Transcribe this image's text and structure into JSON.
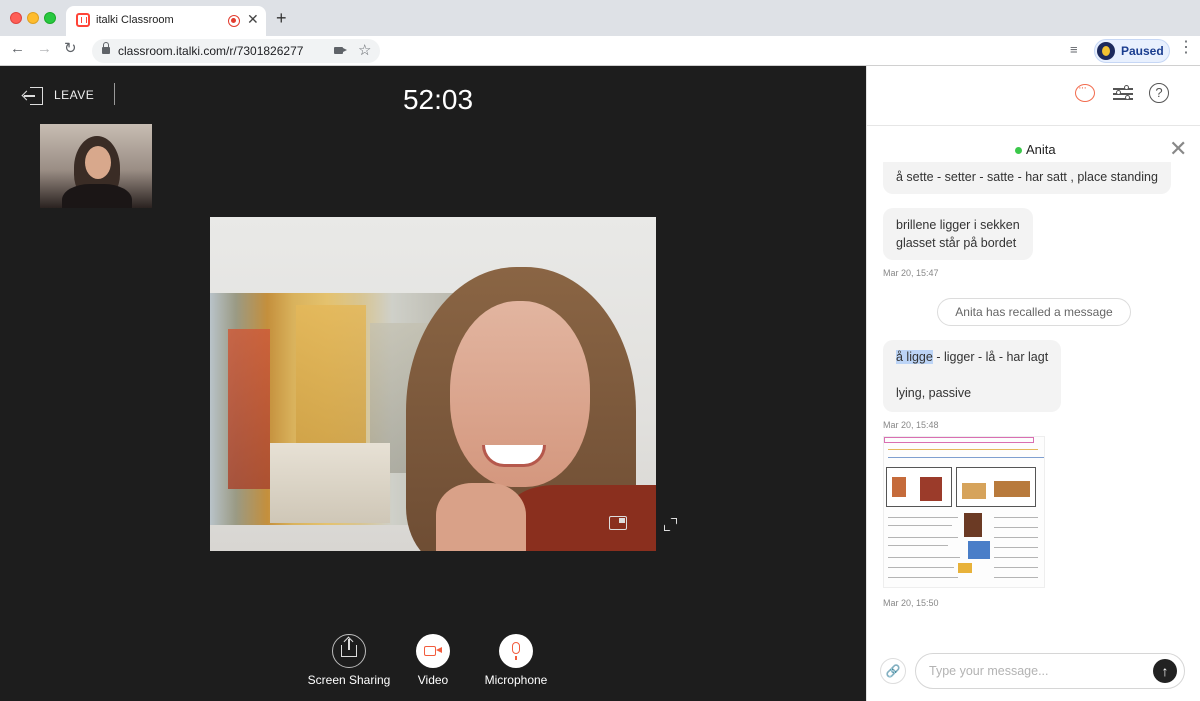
{
  "browser": {
    "tab_title": "italki Classroom",
    "tab_close": "✕",
    "new_tab": "+",
    "url": "classroom.italki.com/r/7301826277",
    "profile_status": "Paused",
    "menu": "⋮",
    "nav": {
      "back": "←",
      "forward": "→",
      "reload": "↻",
      "star": "☆",
      "media": "≡"
    }
  },
  "classroom": {
    "leave_label": "LEAVE",
    "timer": "52:03",
    "controls": [
      {
        "label": "Screen Sharing"
      },
      {
        "label": "Video"
      },
      {
        "label": "Microphone"
      }
    ]
  },
  "chat": {
    "peer_name": "Anita",
    "close": "✕",
    "help": "?",
    "messages": [
      {
        "line1": "å sette - setter - satte - har satt , place standing"
      },
      {
        "line1": "brillene ligger i sekken",
        "line2": "glasset står på bordet",
        "time": "Mar 20, 15:47"
      },
      {
        "system": "Anita has recalled a message"
      },
      {
        "highlight": "å ligge",
        "rest": " - ligger - lå - har lagt",
        "line2": "lying, passive",
        "time": "Mar 20, 15:48"
      },
      {
        "time": "Mar 20, 15:50"
      }
    ],
    "composer": {
      "attach": "🔗",
      "placeholder": "Type your message...",
      "send": "↑"
    }
  },
  "colors": {
    "accent": "#f26d4f",
    "online": "#3bc84a",
    "stage_bg": "#1d1d1d"
  }
}
